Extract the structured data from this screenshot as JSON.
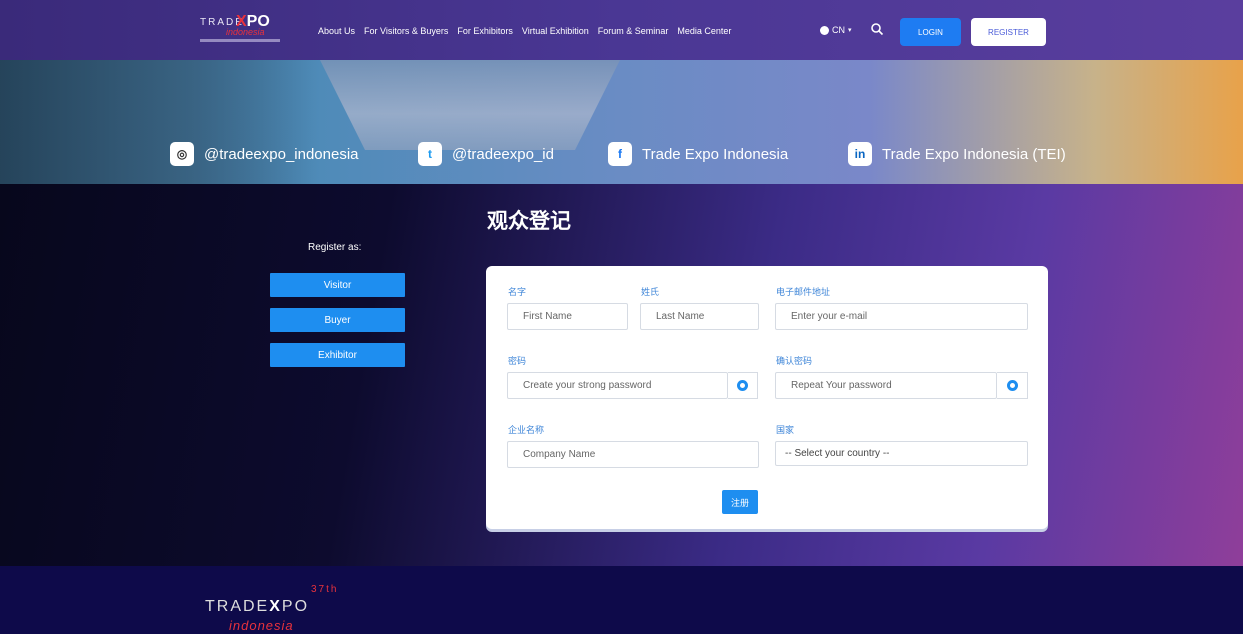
{
  "nav": {
    "logo": {
      "trade": "TRADE",
      "expo_x": "X",
      "expo": "PO",
      "indonesia": "indonesia"
    },
    "menu": [
      "About Us",
      "For Visitors & Buyers",
      "For Exhibitors",
      "Virtual Exhibition",
      "Forum & Seminar",
      "Media Center"
    ],
    "lang": "CN",
    "login": "LOGIN",
    "register": "REGISTER"
  },
  "social": {
    "instagram": "@tradeexpo_indonesia",
    "twitter": "@tradeexpo_id",
    "facebook": "Trade Expo Indonesia",
    "linkedin": "Trade Expo Indonesia (TEI)"
  },
  "page": {
    "title": "观众登记",
    "register_as": "Register as:",
    "roles": [
      "Visitor",
      "Buyer",
      "Exhibitor"
    ]
  },
  "form": {
    "first_name": {
      "label": "名字",
      "placeholder": "First Name"
    },
    "last_name": {
      "label": "姓氏",
      "placeholder": "Last Name"
    },
    "email": {
      "label": "电子邮件地址",
      "placeholder": "Enter your e-mail"
    },
    "password": {
      "label": "密码",
      "placeholder": "Create your strong password"
    },
    "confirm_password": {
      "label": "确认密码",
      "placeholder": "Repeat Your password"
    },
    "company": {
      "label": "企业名称",
      "placeholder": "Company Name"
    },
    "country": {
      "label": "国家",
      "selected": "-- Select your country --"
    },
    "submit": "注册"
  },
  "footer": {
    "trade": "TRADE",
    "expo_x": "X",
    "expo": "PO",
    "sup": "37th",
    "indonesia": "indonesia"
  },
  "colors": {
    "accent": "#1e8ef0",
    "label": "#3f86d8"
  }
}
